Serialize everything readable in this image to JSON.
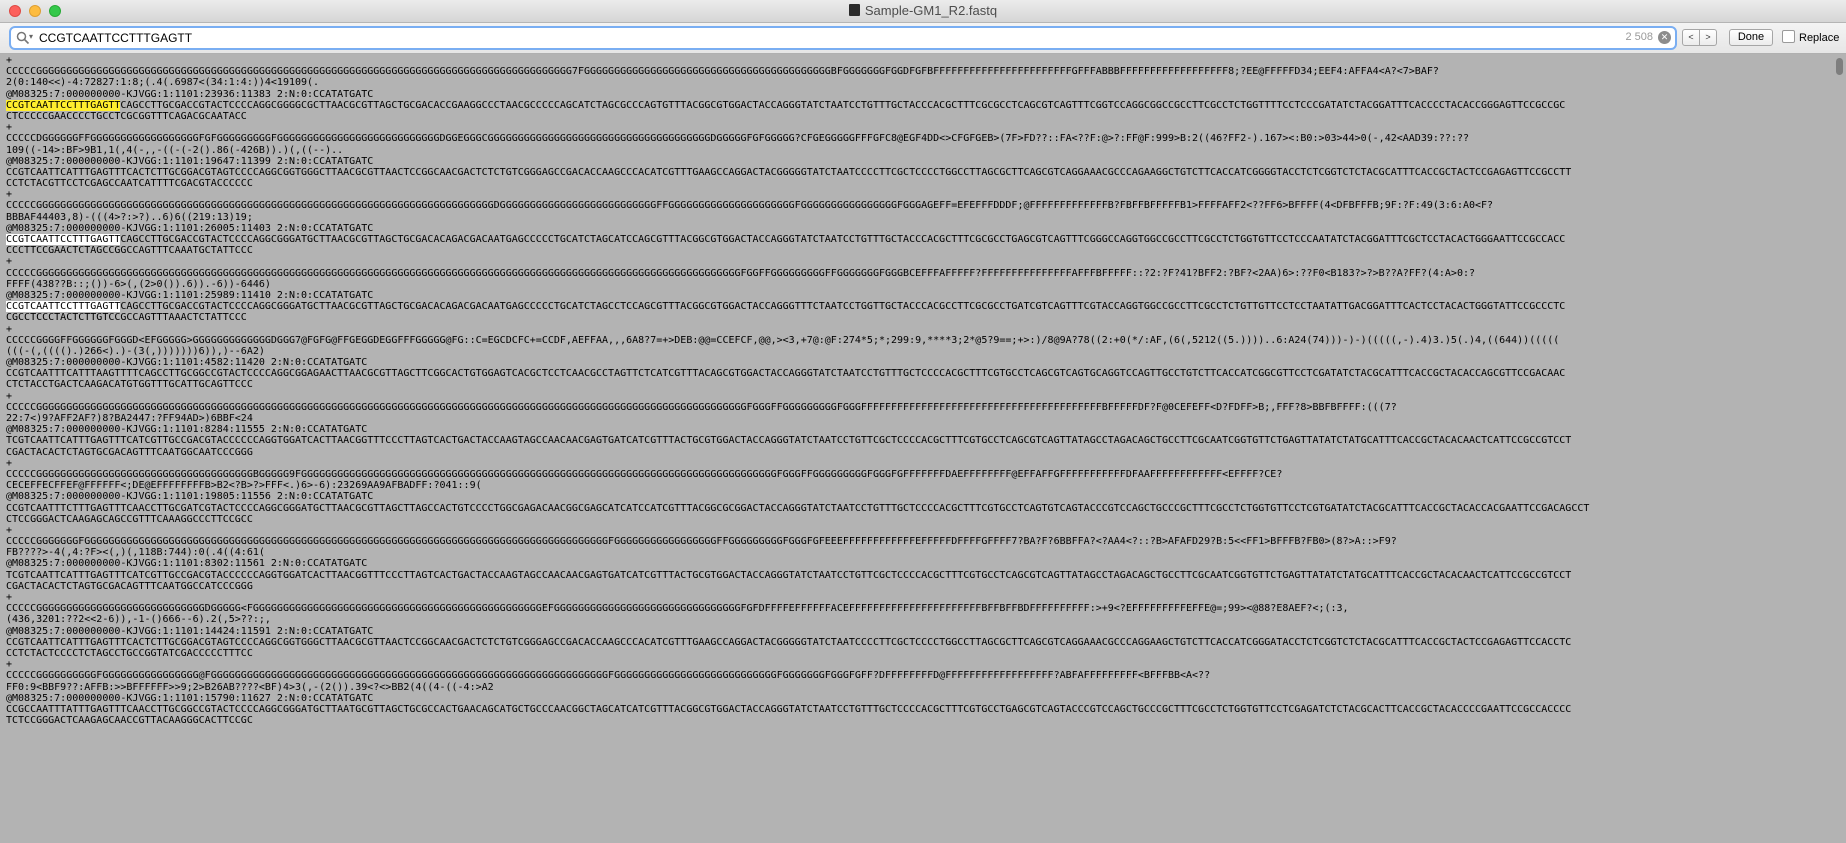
{
  "window": {
    "title": "Sample-GM1_R2.fastq"
  },
  "find": {
    "query": "CCGTCAATTCCTTTGAGTT",
    "match_count": "2 508",
    "done_label": "Done",
    "replace_label": "Replace",
    "prev_label": "<",
    "next_label": ">"
  },
  "lines": [
    [
      "+"
    ],
    [
      "CCCCCGGGGGGGGGGGGGGGGGGGGGGGGGGGGGGGGGGGGGGGGGGGGGGGGGGGGGGGGGGGGGGGGGGGGGGGGGGGGGGGGGGGGGGGGG7FGGGGGGGGGGGGGGGGGGGGGGGGGGGGGGGGGGGGGGGGGBFGGGGGGGFGGDFGFBFFFFFFFFFFFFFFFFFFFFFFFGFFFABBBFFFFFFFFFFFFFFFFFF8;?EE@FFFFFD34;EEF4:AFFA4<A?<7>BAF?"
    ],
    [
      "2(0:140<<)-4:72827:1:8;(.4(.6987<(34:1:4:))4<19109(."
    ],
    [
      "@M08325:7:000000000-KJVGG:1:1101:23936:11383 2:N:0:CCATATGATC"
    ],
    [
      {
        "t": "CCGTCAATTCCTTTGAGTT",
        "h": "cur"
      },
      "CAGCCTTGCGACCGTACTCCCCAGGCGGGGCGCTTAACGCGTTAGCTGCGACACCGAAGGCCCTAACGCCCCCAGCATCTAGCGCCCAGTGTTTACGGCGTGGACTACCAGGGTATCTAATCCTGTTTGCTACCCACGCTTTCGCGCCTCAGCGTCAGTTTCGGTCCAGGCGGCCGCCTTCGCCTCTGGTTTTCCTCCCGATATCTACGGATTTCACCCCTACACCGGGAGTTCCGCCGC"
    ],
    [
      "CTCCCCCGAACCCCTGCCTCGCGGTTTCAGACGCAATACC"
    ],
    [
      "+"
    ],
    [
      "CCCCCDGGGGGGFFGGGGGGGGGGGGGGGGGGFGFGGGGGGGGGFGGGGGGGGGGGGGGGGGGGGGGGGGGGDGGEGGGCGGGGGGGGGGGGGGGGGGGGGGGGGGGGGGGGGGGGGDGGGGGFGFGGGGG?CFGEGGGGGFFFGFC8@EGF4DD<>CFGFGEB>(7F>FD??::FA<??F:@>?:FF@F:999>B:2((46?FF2-).167><:B0:>03>44>0(-,42<AAD39:??:??"
    ],
    [
      "109((-14>:BF>9B1,1(,4(-,,-((-(-2().86(-426B)).)(,((--).."
    ],
    [
      "@M08325:7:000000000-KJVGG:1:1101:19647:11399 2:N:0:CCATATGATC"
    ],
    [
      "CCGTCAATTCATTTGAGTTTCACTCTTGCGGACGTAGTCCCCAGGCGGTGGGCTTAACGCGTTAACTCCGGCAACGACTCTCTGTCGGGAGCCGACACCAAGCCCACATCGTTTGAAGCCAGGACTACGGGGGTATCTAATCCCCTTCGCTCCCCTGGCCTTAGCGCTTCAGCGTCAGGAAACGCCCAGAAGGCTGTCTTCACCATCGGGGTACCTCTCGGTCTCTACGCATTTCACCGCTACTCCGAGAGTTCCGCCTT"
    ],
    [
      "CCTCTACGTTCCTCGAGCCAATCATTTTCGACGTACCCCCC"
    ],
    [
      "+"
    ],
    [
      "CCCCCGGGGGGGGGGGGGGGGGGGGGGGGGGGGGGGGGGGGGGGGGGGGGGGGGGGGGGGGGGGGGGGGGGGGGGGGGGGGDGGGGGGGGGGGGGGGGGGGGGGGGGGFFGGGGGGGGGGGGGGGGGGGGGFGGGGGGGGGGGGGGGGFGGGAGEFF=EFEFFFDDDF;@FFFFFFFFFFFFFB?FBFFBFFFFFB1>FFFFAFF2<??FF6>BFFFF(4<DFBFFFB;9F:?F:49(3:6:A0<F?"
    ],
    [
      "BBBAF44403,8)-(((4>?:>?)..6)6((219:13)19;"
    ],
    [
      "@M08325:7:000000000-KJVGG:1:1101:26005:11403 2:N:0:CCATATGATC"
    ],
    [
      {
        "t": "CCGTCAATTCCTTTGAGTT",
        "h": "w"
      },
      "CAGCCTTGCGACCGTACTCCCCAGGCGGGATGCTTAACGCGTTAGCTGCGACACAGACGACAATGAGCCCCCTGCATCTAGCATCCAGCGTTTACGGCGTGGACTACCAGGGTATCTAATCCTGTTTGCTACCCACGCTTTCGCGCCTGAGCGTCAGTTTCGGGCCAGGTGGCCGCCTTCGCCTCTGGTGTTCCTCCCAATATCTACGGATTTCGCTCCTACACTGGGAATTCCGCCACC"
    ],
    [
      "CCCTTCCGAACTCTAGCCGGCCAGTTTCAAATGCTATTCCC"
    ],
    [
      "+"
    ],
    [
      "CCCCCGGGGGGGGGGGGGGGGGGGGGGGGGGGGGGGGGGGGGGGGGGGGGGGGGGGGGGGGGGGGGGGGGGGGGGGGGGGGGGGGGGGGGGGGGGGGGGGGGGGGGGGGGGGGGGGGGGGGGFGGFFGGGGGGGGGFFGGGGGGGFGGGBCEFFFAFFFFF?FFFFFFFFFFFFFFFAFFFBFFFFF::?2:?F?41?BFF2:?BF?<2AA)6>:??F0<B183?>?>B??A?FF?(4:A>0:?"
    ],
    [
      "FFFF(438??B::;())-6>(,(2>0()).6)).-6))-6446)"
    ],
    [
      "@M08325:7:000000000-KJVGG:1:1101:25989:11410 2:N:0:CCATATGATC"
    ],
    [
      {
        "t": "CCGTCAATTCCTTTGAGTT",
        "h": "w"
      },
      "CAGCCTTGCGACCGTACTCCCCAGGCGGGATGCTTAACGCGTTAGCTGCGACACAGACGACAATGAGCCCCCTGCATCTAGCCTCCAGCGTTTACGGCGTGGACTACCAGGGTTTCTAATCCTGGTTGCTACCCACGCCTTCGCGCCTGATCGTCAGTTTCGTACCAGGTGGCCGCCTTCGCCTCTGTTGTTCCTCCTAATATTGACGGATTTCACTCCTACACTGGGTATTCCGCCCTC"
    ],
    [
      "CGCCTCCCTACTCTTGTCCGCCAGTTTAAACTCTATTCCC"
    ],
    [
      "+"
    ],
    [
      "CCCCCGGGGFFGGGGGGFGGGD<EFGGGGG>GGGGGGGGGGGGGDGGG7@FGFG@FFGEGGDEGGFFFGGGGG@FG::C=EGCDCFC+=CCDF,AEFFAA,,,6A8?7=+>DEB:@@=CCEFCF,@@,><3,+7@:@F:274*5;*;299:9,****3;2*@5?9==;+>:)/8@9A?78((2:+0(*/:AF,(6(,5212((5.))))..6:A24(74)))-)-)(((((,-).4)3.)5(.)4,((644))((((("
    ],
    [
      "(((-(,(((().)266<).)-(3(,)))))))6)),)--6A2)"
    ],
    [
      "@M08325:7:000000000-KJVGG:1:1101:4582:11420 2:N:0:CCATATGATC"
    ],
    [
      "CCGTCAATTTCATTTAAGTTTTCAGCCTTGCGGCCGTACTCCCCAGGCGGAGAACTTAACGCGTTAGCTTCGGCACTGTGGAGTCACGCTCCTCAACGCCTAGTTCTCATCGTTTACAGCGTGGACTACCAGGGTATCTAATCCTGTTTGCTCCCCACGCTTTCGTGCCTCAGCGTCAGTGCAGGTCCAGTTGCCTGTCTTCACCATCGGCGTTCCTCGATATCTACGCATTTCACCGCTACACCAGCGTTCCGACAAC"
    ],
    [
      "CTCTACCTGACTCAAGACATGTGGTTTGCATTGCAGTTCCC"
    ],
    [
      "+"
    ],
    [
      "CCCCCGGGGGGGGGGGGGGGGGGGGGGGGGGGGGGGGGGGGGGGGGGGGGGGGGGGGGGGGGGGGGGGGGGGGGGGGGGGGGGGGGGGGGGGGGGGGGGGGGGGGGGGGGGGGGGGGGGGGGGFGGGFFGGGGGGGGGFGGGFFFFFFFFFFFFFFFFFFFFFFFFFFFFFFFFFFFFFFFFBFFFFFDF?F@0CEFEFF<D?FDFF>B;,FFF?8>BBFBFFFF:(((7?"
    ],
    [
      "22:7<)9?AFF2AF?)8?BA2447:?FF94AD>)6BBF<24"
    ],
    [
      "@M08325:7:000000000-KJVGG:1:1101:8284:11555 2:N:0:CCATATGATC"
    ],
    [
      "TCGTCAATTCATTTGAGTTTCATCGTTGCCGACGTACCCCCCAGGTGGATCACTTAACGGTTTCCCTTAGTCACTGACTACCAAGTAGCCAACAACGAGTGATCATCGTTTACTGCGTGGACTACCAGGGTATCTAATCCTGTTCGCTCCCCACGCTTTCGTGCCTCAGCGTCAGTTATAGCCTAGACAGCTGCCTTCGCAATCGGTGTTCTGAGTTATATCTATGCATTTCACCGCTACACAACTCATTCCGCCGTCCT"
    ],
    [
      "CGACTACACTCTAGTGCGACAGTTTCAATGGCAATCCCGGG"
    ],
    [
      "+"
    ],
    [
      "CCCCCGGGGGGGGGGGGGGGGGGGGGGGGGGGGGGGGGGGGBGGGGG9FGGGGGGGGGGGGGGGGGGGGGGGGGGGGGGGGGGGGGGGGGGGGGGGGGGGGGGGGGGGGGGGGGGGGGGGGGGGGGGGFGGGFFGGGGGGGGGFGGGFGFFFFFFFDAEFFFFFFFF@EFFAFFGFFFFFFFFFFFDFAAFFFFFFFFFFFF<EFFFF?CE?"
    ],
    [
      "CECEFFECFFEF@FFFFFF<;DE@EFFFFFFFFB>B2<?B>?>FFF<.)6>-6):23269AA9AFBADFF:?041::9("
    ],
    [
      "@M08325:7:000000000-KJVGG:1:1101:19805:11556 2:N:0:CCATATGATC"
    ],
    [
      "CCGTCAATTTCTTTGAGTTTCAACCTTGCGATCGTACTCCCCAGGCGGGATGCTTAACGCGTTAGCTTAGCCACTGTCCCCTGGCGAGACAACGGCGAGCATCATCCATCGTTTACGGCGCGGACTACCAGGGTATCTAATCCTGTTTGCTCCCCACGCTTTCGTGCCTCAGTGTCAGTACCCGTCCAGCTGCCCGCTTTCGCCTCTGGTGTTCCTCGTGATATCTACGCATTTCACCGCTACACCACGAATTCCGACAGCCT"
    ],
    [
      "CTCCGGGACTCAAGAGCAGCCGTTTCAAAGGCCCTTCCGCC"
    ],
    [
      "+"
    ],
    [
      "CCCCCGGGGGGGFGGGGGGGGGGGGGGGGGGGGGGGGGGGGGGGGGGGGGGGGGGGGGGGGGGGGGGGGGGGGGGGGGGGGGGGGGGGGGGGGGGGGGGGFGGGGGGGGGGGGGGGGGFFGGGGGGGGGFGGGFGFEEEFFFFFFFFFFFFEFFFFFDFFFFGFFFF7?BA?F?6BBFFA?<?AA4<?::?B>AFAFD29?B:5<<FF1>BFFFB?FB0>(8?>A::>F9?"
    ],
    [
      "FB????>-4(,4:?F><(,)(,118B:744):0(.4((4:61("
    ],
    [
      "@M08325:7:000000000-KJVGG:1:1101:8302:11561 2:N:0:CCATATGATC"
    ],
    [
      "TCGTCAATTCATTTGAGTTTCATCGTTGCCGACGTACCCCCCAGGTGGATCACTTAACGGTTTCCCTTAGTCACTGACTACCAAGTAGCCAACAACGAGTGATCATCGTTTACTGCGTGGACTACCAGGGTATCTAATCCTGTTCGCTCCCCACGCTTTCGTGCCTCAGCGTCAGTTATAGCCTAGACAGCTGCCTTCGCAATCGGTGTTCTGAGTTATATCTATGCATTTCACCGCTACACAACTCATTCCGCCGTCCT"
    ],
    [
      "CGACTACACTCTAGTGCGACAGTTTCAATGGCCATCCCGGG"
    ],
    [
      "+"
    ],
    [
      "CCCCCGGGGGGGGGGGGGGGGGGGGGGGGGGGGDGGGGG<FGGGGGGGGGGGGGGGGGGGGGGGGGGGGGGGGGGGGGGGGGGGGGGGGEFGGGGGGGGGGGGGGGGGGGGGGGGGGGGGGGFGFDFFFFEFFFFFFACEFFFFFFFFFFFFFFFFFFFFFFBFFBFFBDFFFFFFFFFF:>+9<?EFFFFFFFFFEFFE@=;99><@88?E8AEF?<;(:3,"
    ],
    [
      "(436,3201:??2<<2-6)),-1-()666--6).2(,5>??:;,"
    ],
    [
      "@M08325:7:000000000-KJVGG:1:1101:14424:11591 2:N:0:CCATATGATC"
    ],
    [
      "CCGTCAATTCATTTGAGTTTCACTCTTGCGGACGTAGTCCCCAGGCGGTGGGCTTAACGCGTTAACTCCGGCAACGACTCTCTGTCGGGAGCCGACACCAAGCCCACATCGTTTGAAGCCAGGACTACGGGGGTATCTAATCCCCTTCGCTCCCCTGGCCTTAGCGCTTCAGCGTCAGGAAACGCCCAGGAAGCTGTCTTCACCATCGGGATACCTCTCGGTCTCTACGCATTTCACCGCTACTCCGAGAGTTCCACCTC"
    ],
    [
      "CCTCTACTCCCCTCTAGCCTGCCGGTATCGACCCCCTTTCC"
    ],
    [
      "+"
    ],
    [
      "CCCCCGGGGGGGGGGFGGGGGGGGGGGGGGGG@FGGGGGGGGGGGGGGGGGGGGGGGGGGGGGGGGGGGGGGGGGGGGGGGGGGGGGGGGGGGGGGGGGGFGGGGGGGGGGGGGGGGGGGGGGGGGGGFGGGGGGGFGGGFGFF?DFFFFFFFFD@FFFFFFFFFFFFFFFFFF?ABFAFFFFFFFFF<BFFFBB<A<??"
    ],
    [
      "FF0:9<BBF9??:AFFB:>>BFFFFFF>>9;2>B26AB????<BF)4>3(,-(2()).39<?<>BB2(4((4-((-4:>A2"
    ],
    [
      "@M08325:7:000000000-KJVGG:1:1101:15790:11627 2:N:0:CCATATGATC"
    ],
    [
      "CCGCCAATTTATTTGAGTTTCAACCTTGCGGCCGTACTCCCCAGGCGGGATGCTTAATGCGTTAGCTGCGCCACTGAACAGCATGCTGCCCAACGGCTAGCATCATCGTTTACGGCGTGGACTACCAGGGTATCTAATCCTGTTTGCTCCCCACGCTTTCGTGCCTGAGCGTCAGTACCCGTCCAGCTGCCCGCTTTCGCCTCTGGTGTTCCTCGAGATCTCTACGCACTTCACCGCTACACCCCGAATTCCGCCACCCC"
    ],
    [
      "TCTCCGGGACTCAAGAGCAACCGTTACAAGGGCACTTCCGC"
    ]
  ]
}
